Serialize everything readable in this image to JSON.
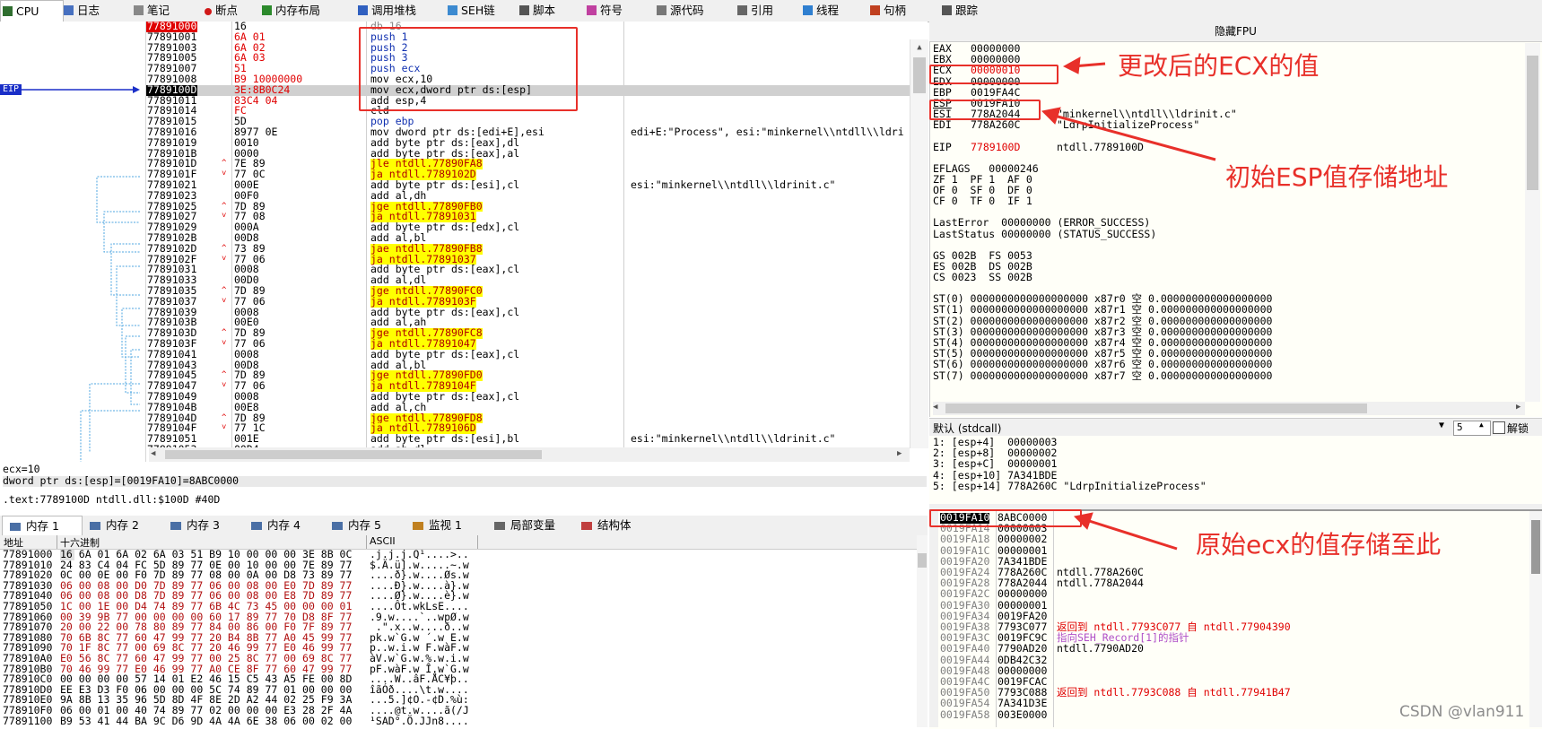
{
  "tabs": [
    {
      "label": "CPU",
      "icon": "cpu-icon",
      "active": true
    },
    {
      "label": "日志",
      "icon": "log-icon"
    },
    {
      "label": "笔记",
      "icon": "notes-icon"
    },
    {
      "label": "断点",
      "icon": "breakpoint-icon"
    },
    {
      "label": "内存布局",
      "icon": "memory-map-icon"
    },
    {
      "label": "调用堆栈",
      "icon": "callstack-icon"
    },
    {
      "label": "SEH链",
      "icon": "seh-icon"
    },
    {
      "label": "脚本",
      "icon": "script-icon"
    },
    {
      "label": "符号",
      "icon": "symbol-icon"
    },
    {
      "label": "源代码",
      "icon": "source-icon"
    },
    {
      "label": "引用",
      "icon": "references-icon"
    },
    {
      "label": "线程",
      "icon": "threads-icon"
    },
    {
      "label": "句柄",
      "icon": "handles-icon"
    },
    {
      "label": "跟踪",
      "icon": "trace-icon"
    }
  ],
  "disasm": {
    "eip_label": "EIP",
    "rows": [
      {
        "addr": "77891000",
        "bytes": "16",
        "instr": "db 16",
        "comment": ""
      },
      {
        "addr": "77891001",
        "bytes": "6A 01",
        "instr": "push 1",
        "comment": ""
      },
      {
        "addr": "77891003",
        "bytes": "6A 02",
        "instr": "push 2",
        "comment": ""
      },
      {
        "addr": "77891005",
        "bytes": "6A 03",
        "instr": "push 3",
        "comment": ""
      },
      {
        "addr": "77891007",
        "bytes": "51",
        "instr": "push ecx",
        "comment": ""
      },
      {
        "addr": "77891008",
        "bytes": "B9 10000000",
        "instr": "mov ecx,10",
        "comment": ""
      },
      {
        "addr": "7789100D",
        "bytes": "3E:8B0C24",
        "instr": "mov ecx,dword ptr ds:[esp]",
        "comment": ""
      },
      {
        "addr": "77891011",
        "bytes": "83C4 04",
        "instr": "add esp,4",
        "comment": ""
      },
      {
        "addr": "77891014",
        "bytes": "FC",
        "instr": "cld",
        "comment": ""
      },
      {
        "addr": "77891015",
        "bytes": "5D",
        "instr": "pop ebp",
        "comment": ""
      },
      {
        "addr": "77891016",
        "bytes": "8977 0E",
        "instr": "mov dword ptr ds:[edi+E],esi",
        "comment": "edi+E:\"Process\", esi:\"minkernel\\\\ntdll\\\\ldri"
      },
      {
        "addr": "77891019",
        "bytes": "0010",
        "instr": "add byte ptr ds:[eax],dl",
        "comment": ""
      },
      {
        "addr": "7789101B",
        "bytes": "0000",
        "instr": "add byte ptr ds:[eax],al",
        "comment": ""
      },
      {
        "addr": "7789101D",
        "bytes": "7E 89",
        "instr": "jle ntdll.77890FA8",
        "comment": ""
      },
      {
        "addr": "7789101F",
        "bytes": "77 0C",
        "instr": "ja ntdll.7789102D",
        "comment": ""
      },
      {
        "addr": "77891021",
        "bytes": "000E",
        "instr": "add byte ptr ds:[esi],cl",
        "comment": "esi:\"minkernel\\\\ntdll\\\\ldrinit.c\""
      },
      {
        "addr": "77891023",
        "bytes": "00F0",
        "instr": "add al,dh",
        "comment": ""
      },
      {
        "addr": "77891025",
        "bytes": "7D 89",
        "instr": "jge ntdll.77890FB0",
        "comment": ""
      },
      {
        "addr": "77891027",
        "bytes": "77 08",
        "instr": "ja ntdll.77891031",
        "comment": ""
      },
      {
        "addr": "77891029",
        "bytes": "000A",
        "instr": "add byte ptr ds:[edx],cl",
        "comment": ""
      },
      {
        "addr": "7789102B",
        "bytes": "00D8",
        "instr": "add al,bl",
        "comment": ""
      },
      {
        "addr": "7789102D",
        "bytes": "73 89",
        "instr": "jae ntdll.77890FB8",
        "comment": ""
      },
      {
        "addr": "7789102F",
        "bytes": "77 06",
        "instr": "ja ntdll.77891037",
        "comment": ""
      },
      {
        "addr": "77891031",
        "bytes": "0008",
        "instr": "add byte ptr ds:[eax],cl",
        "comment": ""
      },
      {
        "addr": "77891033",
        "bytes": "00D0",
        "instr": "add al,dl",
        "comment": ""
      },
      {
        "addr": "77891035",
        "bytes": "7D 89",
        "instr": "jge ntdll.77890FC0",
        "comment": ""
      },
      {
        "addr": "77891037",
        "bytes": "77 06",
        "instr": "ja ntdll.7789103F",
        "comment": ""
      },
      {
        "addr": "77891039",
        "bytes": "0008",
        "instr": "add byte ptr ds:[eax],cl",
        "comment": ""
      },
      {
        "addr": "7789103B",
        "bytes": "00E0",
        "instr": "add al,ah",
        "comment": ""
      },
      {
        "addr": "7789103D",
        "bytes": "7D 89",
        "instr": "jge ntdll.77890FC8",
        "comment": ""
      },
      {
        "addr": "7789103F",
        "bytes": "77 06",
        "instr": "ja ntdll.77891047",
        "comment": ""
      },
      {
        "addr": "77891041",
        "bytes": "0008",
        "instr": "add byte ptr ds:[eax],cl",
        "comment": ""
      },
      {
        "addr": "77891043",
        "bytes": "00D8",
        "instr": "add al,bl",
        "comment": ""
      },
      {
        "addr": "77891045",
        "bytes": "7D 89",
        "instr": "jge ntdll.77890FD0",
        "comment": ""
      },
      {
        "addr": "77891047",
        "bytes": "77 06",
        "instr": "ja ntdll.7789104F",
        "comment": ""
      },
      {
        "addr": "77891049",
        "bytes": "0008",
        "instr": "add byte ptr ds:[eax],cl",
        "comment": ""
      },
      {
        "addr": "7789104B",
        "bytes": "00E8",
        "instr": "add al,ch",
        "comment": ""
      },
      {
        "addr": "7789104D",
        "bytes": "7D 89",
        "instr": "jge ntdll.77890FD8",
        "comment": ""
      },
      {
        "addr": "7789104F",
        "bytes": "77 1C",
        "instr": "ja ntdll.7789106D",
        "comment": ""
      },
      {
        "addr": "77891051",
        "bytes": "001E",
        "instr": "add byte ptr ds:[esi],bl",
        "comment": "esi:\"minkernel\\\\ntdll\\\\ldrinit.c\""
      },
      {
        "addr": "77891053",
        "bytes": "00D4",
        "instr": "add ah,dl",
        "comment": ""
      }
    ]
  },
  "info": {
    "line1": "ecx=10",
    "line2": "dword ptr ds:[esp]=[0019FA10]=8ABC0000",
    "line3": ".text:7789100D ntdll.dll:$100D #40D"
  },
  "registers": {
    "title": "隐藏FPU",
    "gpr": [
      {
        "name": "EAX",
        "value": "00000000",
        "comment": ""
      },
      {
        "name": "EBX",
        "value": "00000000",
        "comment": ""
      },
      {
        "name": "ECX",
        "value": "00000010",
        "comment": ""
      },
      {
        "name": "EDX",
        "value": "00000000",
        "comment": ""
      },
      {
        "name": "EBP",
        "value": "0019FA4C",
        "comment": ""
      },
      {
        "name": "ESP",
        "value": "0019FA10",
        "comment": ""
      },
      {
        "name": "ESI",
        "value": "778A2044",
        "comment": "\"minkernel\\\\ntdll\\\\ldrinit.c\""
      },
      {
        "name": "EDI",
        "value": "778A260C",
        "comment": "\"LdrpInitializeProcess\""
      }
    ],
    "eip": {
      "name": "EIP",
      "value": "7789100D",
      "comment": "ntdll.7789100D"
    },
    "eflags": "EFLAGS   00000246",
    "flags": [
      "ZF 1  PF 1  AF 0",
      "OF 0  SF 0  DF 0",
      "CF 0  TF 0  IF 1"
    ],
    "lasterror": "LastError  00000000 (ERROR_SUCCESS)",
    "laststatus": "LastStatus 00000000 (STATUS_SUCCESS)",
    "segs": [
      "GS 002B  FS 0053",
      "ES 002B  DS 002B",
      "CS 0023  SS 002B"
    ],
    "st": [
      "ST(0) 0000000000000000000 x87r0 空 0.000000000000000000",
      "ST(1) 0000000000000000000 x87r1 空 0.000000000000000000",
      "ST(2) 0000000000000000000 x87r2 空 0.000000000000000000",
      "ST(3) 0000000000000000000 x87r3 空 0.000000000000000000",
      "ST(4) 0000000000000000000 x87r4 空 0.000000000000000000",
      "ST(5) 0000000000000000000 x87r5 空 0.000000000000000000",
      "ST(6) 0000000000000000000 x87r6 空 0.000000000000000000",
      "ST(7) 0000000000000000000 x87r7 空 0.000000000000000000"
    ]
  },
  "args": {
    "convention": "默认 (stdcall)",
    "count": "5",
    "unlock_label": "解锁",
    "rows": [
      "1: [esp+4]  00000003",
      "2: [esp+8]  00000002",
      "3: [esp+C]  00000001",
      "4: [esp+10] 7A341BDE",
      "5: [esp+14] 778A260C \"LdrpInitializeProcess\""
    ]
  },
  "stack": [
    {
      "addr": "0019FA10",
      "value": "8ABC0000",
      "comment": "",
      "ccolor": ""
    },
    {
      "addr": "0019FA14",
      "value": "00000003",
      "comment": "",
      "ccolor": ""
    },
    {
      "addr": "0019FA18",
      "value": "00000002",
      "comment": "",
      "ccolor": ""
    },
    {
      "addr": "0019FA1C",
      "value": "00000001",
      "comment": "",
      "ccolor": ""
    },
    {
      "addr": "0019FA20",
      "value": "7A341BDE",
      "comment": "",
      "ccolor": ""
    },
    {
      "addr": "0019FA24",
      "value": "778A260C",
      "comment": "ntdll.778A260C",
      "ccolor": "black"
    },
    {
      "addr": "0019FA28",
      "value": "778A2044",
      "comment": "ntdll.778A2044",
      "ccolor": "black"
    },
    {
      "addr": "0019FA2C",
      "value": "00000000",
      "comment": "",
      "ccolor": ""
    },
    {
      "addr": "0019FA30",
      "value": "00000001",
      "comment": "",
      "ccolor": ""
    },
    {
      "addr": "0019FA34",
      "value": "0019FA20",
      "comment": "",
      "ccolor": ""
    },
    {
      "addr": "0019FA38",
      "value": "7793C077",
      "comment": "返回到 ntdll.7793C077 自 ntdll.77904390",
      "ccolor": "red"
    },
    {
      "addr": "0019FA3C",
      "value": "0019FC9C",
      "comment": "指向SEH_Record[1]的指针",
      "ccolor": "purple"
    },
    {
      "addr": "0019FA40",
      "value": "7790AD20",
      "comment": "ntdll.7790AD20",
      "ccolor": "black"
    },
    {
      "addr": "0019FA44",
      "value": "0DB42C32",
      "comment": "",
      "ccolor": ""
    },
    {
      "addr": "0019FA48",
      "value": "00000000",
      "comment": "",
      "ccolor": ""
    },
    {
      "addr": "0019FA4C",
      "value": "0019FCAC",
      "comment": "",
      "ccolor": ""
    },
    {
      "addr": "0019FA50",
      "value": "7793C088",
      "comment": "返回到 ntdll.7793C088 自 ntdll.77941B47",
      "ccolor": "red"
    },
    {
      "addr": "0019FA54",
      "value": "7A341D3E",
      "comment": "",
      "ccolor": ""
    },
    {
      "addr": "0019FA58",
      "value": "003E0000",
      "comment": "",
      "ccolor": ""
    }
  ],
  "memtabs": [
    {
      "label": "内存 1",
      "icon": "dump-icon",
      "active": true
    },
    {
      "label": "内存 2",
      "icon": "dump-icon"
    },
    {
      "label": "内存 3",
      "icon": "dump-icon"
    },
    {
      "label": "内存 4",
      "icon": "dump-icon"
    },
    {
      "label": "内存 5",
      "icon": "dump-icon"
    },
    {
      "label": "监视 1",
      "icon": "watch-icon"
    },
    {
      "label": "局部变量",
      "icon": "locals-icon"
    },
    {
      "label": "结构体",
      "icon": "struct-icon"
    }
  ],
  "dump": {
    "col_addr": "地址",
    "col_hex": "十六进制",
    "col_ascii": "ASCII",
    "rows": [
      {
        "addr": "77891000",
        "hex": "16 6A 01 6A 02 6A 03 51 B9 10 00 00 00 3E 8B 0C",
        "ascii": ".j.j.j.Q¹....>.."
      },
      {
        "addr": "77891010",
        "hex": "24 83 C4 04 FC 5D 89 77 0E 00 10 00 00 7E 89 77",
        "ascii": "$.Ä.ü].w.....~.w"
      },
      {
        "addr": "77891020",
        "hex": "0C 00 0E 00 F0 7D 89 77 08 00 0A 00 D8 73 89 77",
        "ascii": "....ð}.w....Øs.w"
      },
      {
        "addr": "77891030",
        "hex": "06 00 08 00 D0 7D 89 77 06 00 08 00 E0 7D 89 77",
        "ascii": "....Ð}.w....à}.w"
      },
      {
        "addr": "77891040",
        "hex": "06 00 08 00 D8 7D 89 77 06 00 08 00 E8 7D 89 77",
        "ascii": "....Ø}.w....è}.w"
      },
      {
        "addr": "77891050",
        "hex": "1C 00 1E 00 D4 74 89 77 6B 4C 73 45 00 00 00 01",
        "ascii": "....Ôt.wkLsE...."
      },
      {
        "addr": "77891060",
        "hex": "00 39 9B 77 00 00 00 00 60 17 89 77 70 D8 8F 77",
        "ascii": ".9.w....`..wpØ.w"
      },
      {
        "addr": "77891070",
        "hex": "20 00 22 00 78 80 89 77 84 00 86 00 F0 7F 89 77",
        "ascii": " .\".x..w....ð..w"
      },
      {
        "addr": "77891080",
        "hex": "70 6B 8C 77 60 47 99 77 20 B4 8B 77 A0 45 99 77",
        "ascii": "pk.w`G.w ´.w E.w"
      },
      {
        "addr": "77891090",
        "hex": "70 1F 8C 77 00 69 8C 77 20 46 99 77 E0 46 99 77",
        "ascii": "p..w.i.w F.wàF.w"
      },
      {
        "addr": "778910A0",
        "hex": "E0 56 8C 77 60 47 99 77 00 25 8C 77 00 69 8C 77",
        "ascii": "àV.w`G.w.%.w.i.w"
      },
      {
        "addr": "778910B0",
        "hex": "70 46 99 77 E0 46 99 77 A0 CE 8F 77 60 47 99 77",
        "ascii": "pF.wàF.w Î.w`G.w"
      },
      {
        "addr": "778910C0",
        "hex": "00 00 00 00 57 14 01 E2 46 15 C5 43 A5 FE 00 8D",
        "ascii": "....W..âF.ÅC¥þ.."
      },
      {
        "addr": "778910D0",
        "hex": "EE E3 D3 F0 06 00 00 00 5C 74 89 77 01 00 00 00",
        "ascii": "îãÓð....\\t.w...."
      },
      {
        "addr": "778910E0",
        "hex": "9A 8B 13 35 96 5D 8D 4F 8E 2D A2 44 02 25 F9 3A",
        "ascii": "...5.]¢O.-¢D.%ù:"
      },
      {
        "addr": "778910F0",
        "hex": "06 00 01 00 40 74 89 77 02 00 00 00 E3 28 2F 4A",
        "ascii": "....@t.w....ã(/J"
      },
      {
        "addr": "77891100",
        "hex": "B9 53 41 44 BA 9C D6 9D 4A 4A 6E 38 06 00 02 00",
        "ascii": "¹SAD°.Ö.JJn8...."
      }
    ]
  },
  "annotations": {
    "ecx_note": "更改后的ECX的值",
    "esp_note": "初始ESP值存储地址",
    "orig_ecx_note": "原始ecx的值存储至此",
    "watermark": "CSDN @vlan911"
  }
}
